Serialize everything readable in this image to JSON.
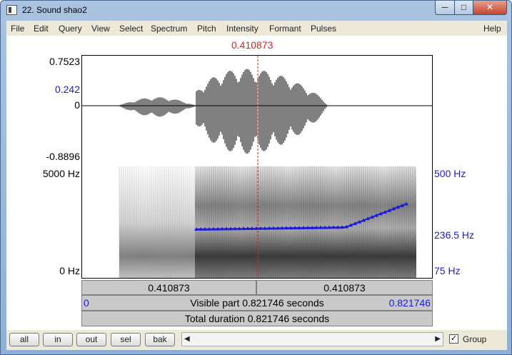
{
  "window": {
    "title": "22. Sound shao2",
    "minimize_glyph": "─",
    "maximize_glyph": "□",
    "close_glyph": "✕"
  },
  "menu": [
    "File",
    "Edit",
    "Query",
    "View",
    "Select",
    "Spectrum",
    "Pitch",
    "Intensity",
    "Formant",
    "Pulses",
    "Help"
  ],
  "cursor_time": "0.410873",
  "waveform": {
    "max": "0.7523",
    "level": "0.242",
    "zero": "0",
    "min": "-0.8896"
  },
  "spectrogram": {
    "freq_max": "5000 Hz",
    "freq_min": "0 Hz"
  },
  "pitch": {
    "max": "500 Hz",
    "mid": "236.5 Hz",
    "min": "75 Hz",
    "color": "#1a1adb"
  },
  "time_bars": {
    "left_segment": "0.410873",
    "right_segment": "0.410873",
    "visible_start": "0",
    "visible_label": "Visible part 0.821746 seconds",
    "visible_end": "0.821746",
    "total_label": "Total duration 0.821746 seconds"
  },
  "bottom": {
    "buttons": [
      "all",
      "in",
      "out",
      "sel",
      "bak"
    ],
    "scroll_left": "◀",
    "scroll_right": "▶",
    "group_label": "Group",
    "group_checked": true,
    "check_glyph": "✓"
  }
}
